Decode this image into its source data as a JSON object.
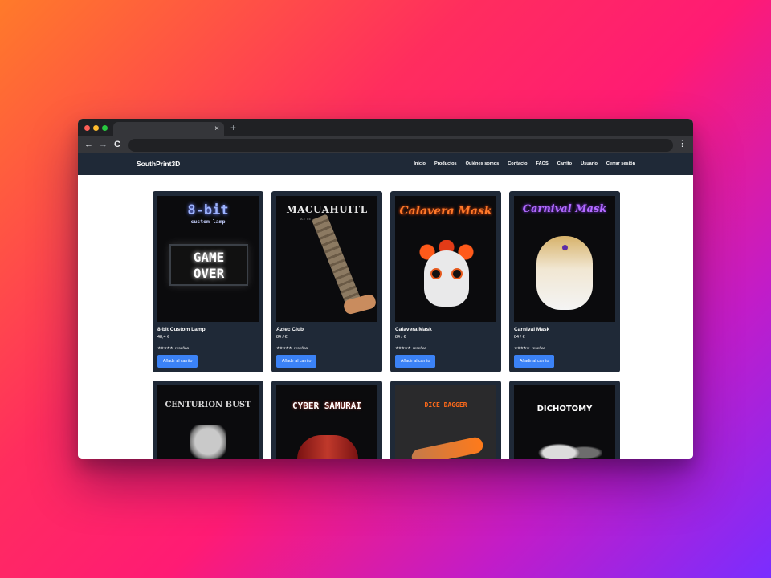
{
  "browser": {
    "tab_close": "×",
    "new_tab": "+",
    "back": "←",
    "forward": "→",
    "reload": "C",
    "menu": "⋮"
  },
  "site": {
    "brand": "SouthPrint3D",
    "nav": [
      "Inicio",
      "Productos",
      "Quiénes somos",
      "Contacto",
      "FAQS",
      "Carrito",
      "Usuario",
      "Cerrar sesión"
    ]
  },
  "products": [
    {
      "name": "8-bit Custom Lamp",
      "price": "48,4 €",
      "stars": "★★★★★",
      "reviews": "reseñas",
      "button": "Añadir al carrito",
      "image_text": {
        "title": "8-bit",
        "subtitle": "custom lamp",
        "line1": "GAME",
        "line2": "OVER"
      }
    },
    {
      "name": "Aztec Club",
      "price": "84 / €",
      "stars": "★★★★★",
      "reviews": "reseñas",
      "button": "Añadir al carrito",
      "image_text": {
        "title": "MACUAHUITL",
        "subtitle": "AZTEC CLUB"
      }
    },
    {
      "name": "Calavera Mask",
      "price": "84 / €",
      "stars": "★★★★★",
      "reviews": "reseñas",
      "button": "Añadir al carrito",
      "image_text": {
        "title": "Calavera Mask"
      }
    },
    {
      "name": "Carnival Mask",
      "price": "84 / €",
      "stars": "★★★★★",
      "reviews": "reseñas",
      "button": "Añadir al carrito",
      "image_text": {
        "title": "Carnival Mask"
      }
    },
    {
      "image_text": {
        "title": "CENTURION BUST"
      }
    },
    {
      "image_text": {
        "title": "CYBER SAMURAI"
      }
    },
    {
      "image_text": {
        "title": "DICE DAGGER"
      }
    },
    {
      "image_text": {
        "title": "DICHOTOMY"
      }
    }
  ],
  "colors": {
    "navbar": "#1f2937",
    "card": "#1f2937",
    "button": "#3b82f6"
  }
}
